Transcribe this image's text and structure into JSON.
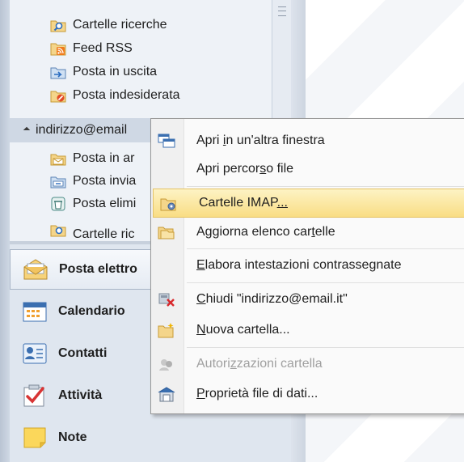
{
  "nav": {
    "folders_top": [
      {
        "label": "Cartelle ricerche",
        "icon": "search-folder-icon"
      },
      {
        "label": "Feed RSS",
        "icon": "rss-feed-icon"
      },
      {
        "label": "Posta in uscita",
        "icon": "outbox-icon"
      },
      {
        "label": "Posta indesiderata",
        "icon": "junk-mail-icon"
      }
    ],
    "account": "indirizzo@email",
    "account_folders": [
      {
        "label": "Posta in ar",
        "icon": "inbox-folder-icon"
      },
      {
        "label": "Posta invia",
        "icon": "sent-folder-icon"
      },
      {
        "label": "Posta elimi",
        "icon": "deleted-folder-icon"
      },
      {
        "label": "Cartelle ric",
        "icon": "search-folder-icon"
      }
    ],
    "modules": [
      {
        "label": "Posta elettro",
        "icon": "mail-icon",
        "active": true
      },
      {
        "label": "Calendario",
        "icon": "calendar-icon"
      },
      {
        "label": "Contatti",
        "icon": "contacts-icon"
      },
      {
        "label": "Attività",
        "icon": "tasks-icon"
      },
      {
        "label": "Note",
        "icon": "notes-icon"
      }
    ]
  },
  "menu": {
    "items": [
      {
        "pre": "Apri ",
        "key": "i",
        "post": "n un'altra finestra",
        "icon": "new-window-icon"
      },
      {
        "pre": "Apri percor",
        "key": "s",
        "post": "o file",
        "icon": ""
      },
      {
        "pre": "Cartelle IMAP",
        "key": "",
        "post": "...",
        "icon": "imap-folders-icon",
        "highlighted": true
      },
      {
        "pre": "Aggiorna elenco car",
        "key": "t",
        "post": "elle",
        "icon": "update-folder-list-icon"
      },
      {
        "pre": "",
        "key": "E",
        "post": "labora intestazioni contrassegnate",
        "icon": ""
      },
      {
        "pre": "",
        "key": "C",
        "post": "hiudi \"indirizzo@email.it\"",
        "icon": "close-account-icon"
      },
      {
        "pre": "",
        "key": "N",
        "post": "uova cartella...",
        "icon": "new-folder-icon"
      },
      {
        "pre": "Autori",
        "key": "z",
        "post": "zazioni cartella",
        "icon": "folder-permissions-icon",
        "disabled": true
      },
      {
        "pre": "",
        "key": "P",
        "post": "roprietà file di dati...",
        "icon": "data-file-properties-icon"
      }
    ]
  },
  "colors": {
    "highlight_top": "#fdf3c4",
    "highlight_bottom": "#f9dd84",
    "nav_background": "#dfe6ef"
  }
}
